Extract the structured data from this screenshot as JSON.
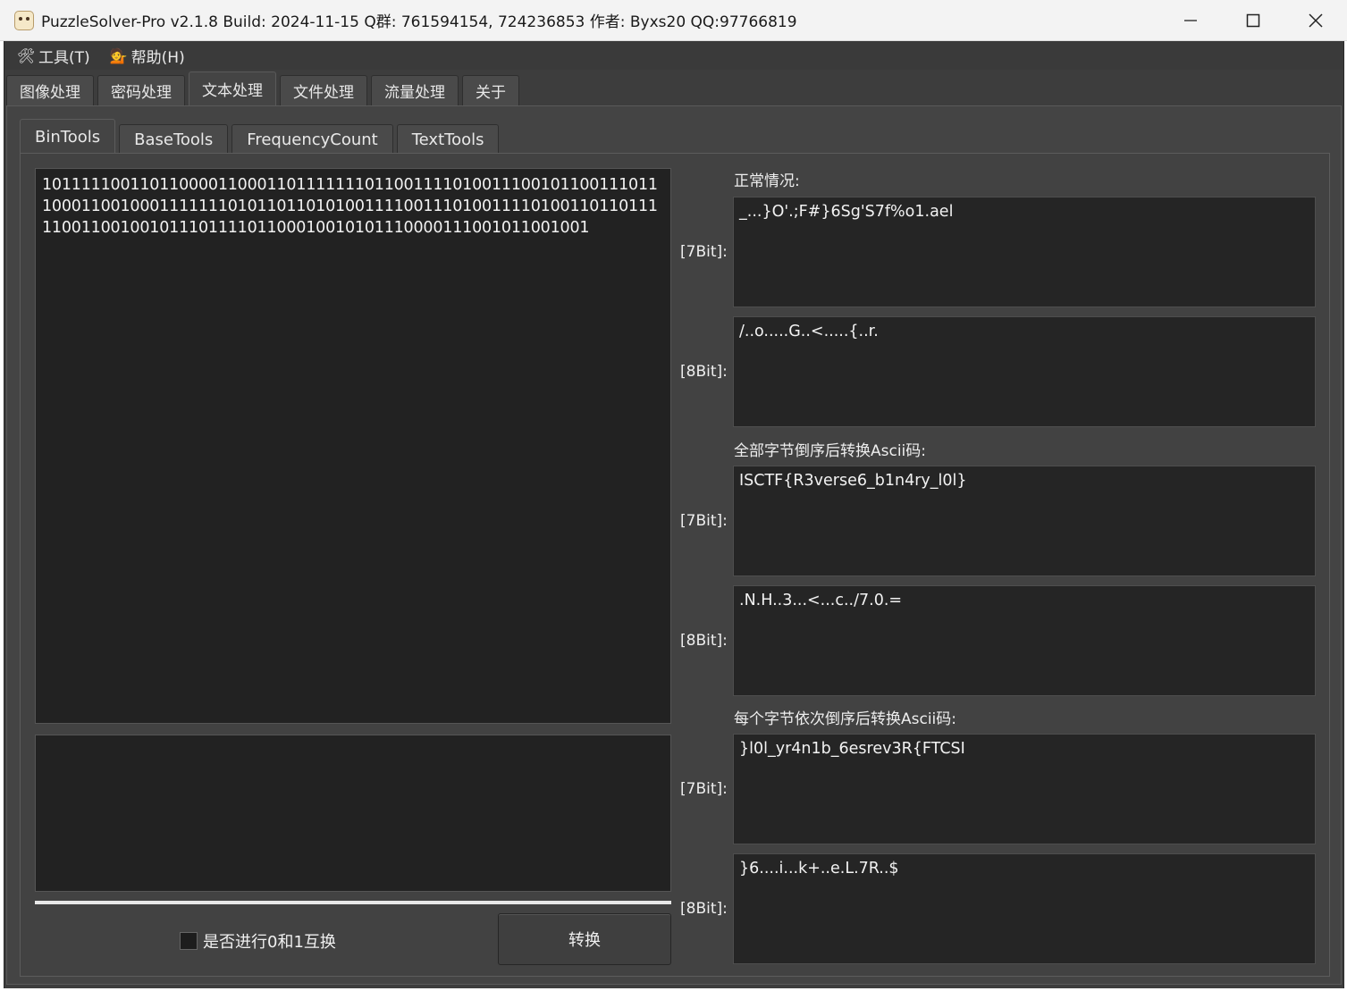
{
  "window": {
    "title": "PuzzleSolver-Pro v2.1.8  Build: 2024-11-15  Q群: 761594154, 724236853  作者: Byxs20  QQ:97766819"
  },
  "menubar": {
    "items": [
      {
        "label": "工具(T)",
        "icon": "tools-icon"
      },
      {
        "label": "帮助(H)",
        "icon": "person-help-icon"
      }
    ]
  },
  "main_tabs": [
    "图像处理",
    "密码处理",
    "文本处理",
    "文件处理",
    "流量处理",
    "关于"
  ],
  "main_tab_active": "文本处理",
  "sub_tabs": [
    "BinTools",
    "BaseTools",
    "FrequencyCount",
    "TextTools"
  ],
  "sub_tab_active": "BinTools",
  "input": {
    "value": "10111110011011000011000110111111101100111101001110010110011101110001100100011111110101101101010011110011101001111010011011011111001100100101110111101100010010101110000111001011001001"
  },
  "output": {
    "value": ""
  },
  "options": {
    "swap_label": "是否进行0和1互换",
    "swap_checked": false
  },
  "convert_button": "转换",
  "sections": {
    "normal": {
      "label": "正常情况:",
      "bit7_label": "[7Bit]:",
      "bit7_value": "_...}O'.;F#}6Sg'S7f%o1.ael",
      "bit8_label": "[8Bit]:",
      "bit8_value": "/..o.....G..<.....{..r."
    },
    "all_reversed": {
      "label": "全部字节倒序后转换Ascii码:",
      "bit7_label": "[7Bit]:",
      "bit7_value": "ISCTF{R3verse6_b1n4ry_l0l}",
      "bit8_label": "[8Bit]:",
      "bit8_value": ".N.H..3...<...c../7.0.="
    },
    "each_reversed": {
      "label": "每个字节依次倒序后转换Ascii码:",
      "bit7_label": "[7Bit]:",
      "bit7_value": "}l0l_yr4n1b_6esrev3R{FTCSI",
      "bit8_label": "[8Bit]:",
      "bit8_value": "}6....i...k+..e.L.7R..$"
    }
  }
}
